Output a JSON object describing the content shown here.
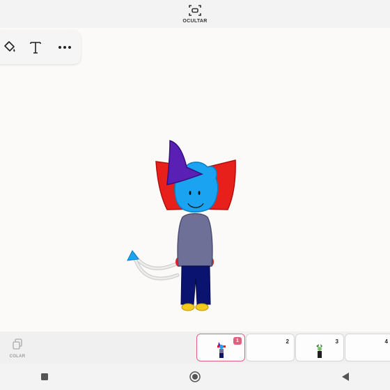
{
  "topbar": {
    "hide_label": "OCULTAR"
  },
  "toolbar": {
    "tools": [
      {
        "icon": "paint-bucket-icon"
      },
      {
        "icon": "text-icon"
      },
      {
        "icon": "more-icon"
      }
    ]
  },
  "bottom": {
    "paste_label": "COLAR",
    "frames": [
      {
        "number": "1",
        "selected": true
      },
      {
        "number": "2",
        "selected": false
      },
      {
        "number": "3",
        "selected": false
      },
      {
        "number": "4",
        "selected": false
      }
    ]
  },
  "navbar": {
    "icons": [
      "stop-icon",
      "home-icon",
      "back-icon"
    ]
  },
  "colors": {
    "accent": "#e0607e",
    "ears": "#e8201c",
    "hat": "#5a1fb5",
    "head": "#1aa3f0",
    "sweater": "#6f7098",
    "pants": "#0a1470",
    "shoes": "#f2cb1d",
    "tail": "#d9d9d9"
  }
}
